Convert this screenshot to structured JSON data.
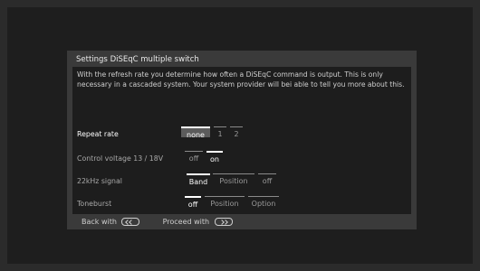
{
  "dialog": {
    "title": "Settings DiSEqC multiple switch",
    "description": "With the refresh rate you determine how often a DiSEqC command is output. This is only necessary in a cascaded system. Your system provider will bei able to tell you more about this."
  },
  "rows": [
    {
      "label": "Repeat rate",
      "options": [
        "none",
        "1",
        "2"
      ],
      "selected": "none"
    },
    {
      "label": "Control voltage 13 / 18V",
      "options": [
        "off",
        "on"
      ],
      "selected": "on"
    },
    {
      "label": "22kHz signal",
      "options": [
        "Band",
        "Position",
        "off"
      ],
      "selected": "Band"
    },
    {
      "label": "Toneburst",
      "options": [
        "off",
        "Position",
        "Option"
      ],
      "selected": "off"
    }
  ],
  "footer": {
    "back": "Back with",
    "proceed": "Proceed with"
  },
  "icons": {
    "back": "back-button-icon",
    "proceed": "proceed-button-icon"
  },
  "colors": {
    "highlight": "#5c5c5c",
    "dialog_bg": "#3a3a3a",
    "content_bg": "#1d1d1d"
  }
}
